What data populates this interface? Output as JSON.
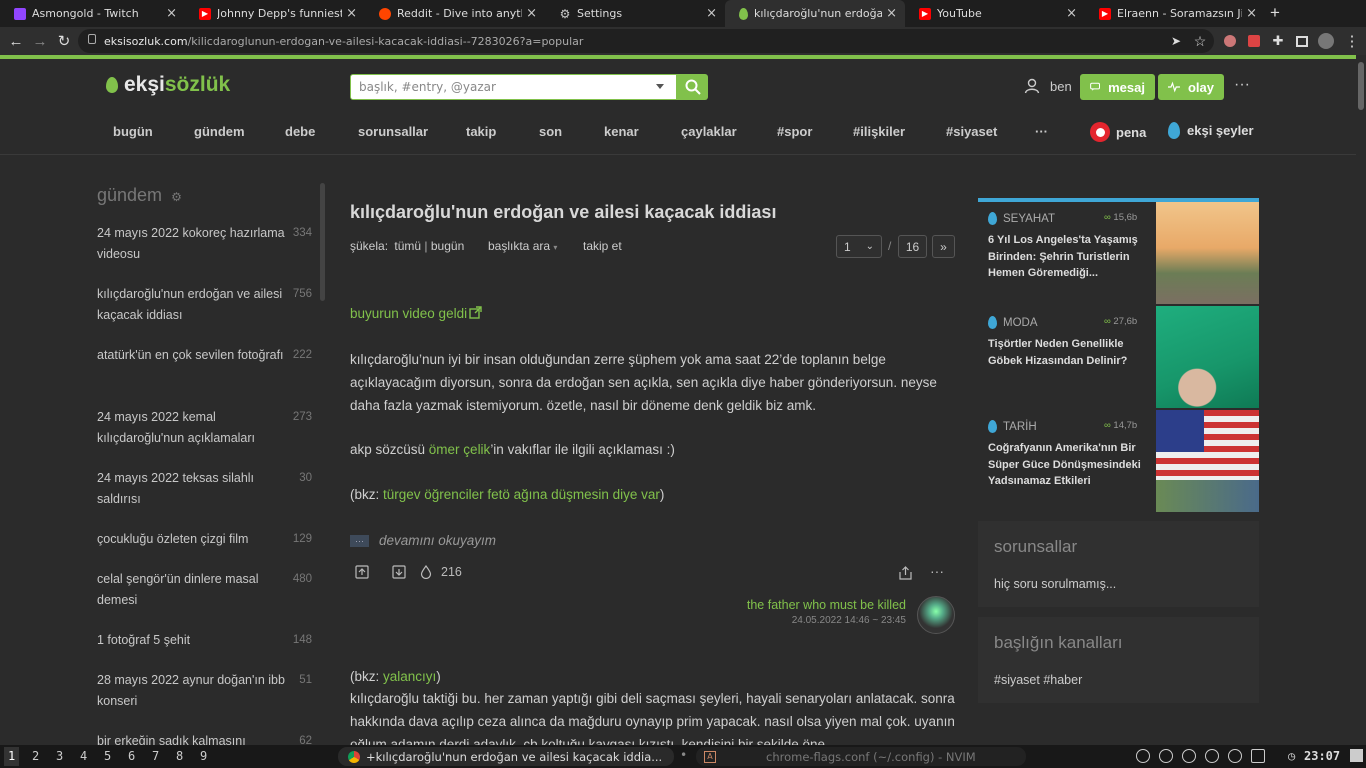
{
  "browser": {
    "tabs": [
      {
        "label": "Asmongold - Twitch",
        "icon": "twitch-icon",
        "color": "#9146ff"
      },
      {
        "label": "Johnny Depp's funniest mom",
        "icon": "youtube-icon",
        "color": "#ff0000"
      },
      {
        "label": "Reddit - Dive into anything",
        "icon": "reddit-icon",
        "color": "#ff4500"
      },
      {
        "label": "Settings",
        "icon": "gear-icon",
        "color": "#cccccc"
      },
      {
        "label": "kılıçdaroğlu'nun erdoğan ve",
        "icon": "eksi-drop-icon",
        "color": "#81c14b"
      },
      {
        "label": "YouTube",
        "icon": "youtube-icon",
        "color": "#ff0000"
      },
      {
        "label": "Elraenn - Soramazsın Jigolo İz",
        "icon": "youtube-icon",
        "color": "#ff0000"
      }
    ],
    "new_tab": "+",
    "url_host": "eksisozluk.com",
    "url_path": "/kilicdaroglunun-erdogan-ve-ailesi-kacacak-iddiasi--7283026?a=popular"
  },
  "site": {
    "logo_part1": "ekşi",
    "logo_part2": "sözlük",
    "search_placeholder": "başlık, #entry, @yazar",
    "user_label": "ben",
    "message_label": "mesaj",
    "event_label": "olay",
    "more": "···",
    "nav": [
      "bugün",
      "gündem",
      "debe",
      "sorunsallar",
      "takip",
      "son",
      "kenar",
      "çaylaklar",
      "#spor",
      "#ilişkiler",
      "#siyaset",
      "···"
    ],
    "pena_label": "pena",
    "eksiseyler_label": "ekşi şeyler",
    "accent": "#81c14b"
  },
  "gundem": {
    "title": "gündem",
    "items": [
      {
        "title": "24 mayıs 2022 kokoreç hazırlama videosu",
        "count": "334"
      },
      {
        "title": "kılıçdaroğlu'nun erdoğan ve ailesi kaçacak iddiası",
        "count": "756"
      },
      {
        "title": "atatürk'ün en çok sevilen fotoğrafı",
        "count": "222"
      },
      {
        "title": "24 mayıs 2022 kemal kılıçdaroğlu'nun açıklamaları",
        "count": "273"
      },
      {
        "title": "24 mayıs 2022 teksas silahlı saldırısı",
        "count": "30"
      },
      {
        "title": "çocukluğu özleten çizgi film",
        "count": "129"
      },
      {
        "title": "celal şengör'ün dinlere masal demesi",
        "count": "480"
      },
      {
        "title": "1 fotoğraf 5 şehit",
        "count": "148"
      },
      {
        "title": "28 mayıs 2022 aynur doğan'ın ibb konseri",
        "count": "51"
      },
      {
        "title": "bir erkeğin sadık kalmasını",
        "count": "62"
      }
    ]
  },
  "topic": {
    "title": "kılıçdaroğlu'nun erdoğan ve ailesi kaçacak iddiası",
    "sukela_label": "şükela:",
    "sukela_all": "tümü",
    "sukela_sep": "|",
    "sukela_today": "bugün",
    "search_in": "başlıkta ara",
    "follow": "takip et",
    "page_current": "1",
    "page_sep": "/",
    "page_total": "16",
    "page_next": "»"
  },
  "entry1": {
    "link": "buyurun video geldi",
    "p1": "kılıçdaroğlu’nun iyi bir insan olduğundan zerre şüphem yok ama saat 22’de toplanın belge açıklayacağım diyorsun, sonra da erdoğan sen açıkla, sen açıkla diye haber gönderiyorsun. neyse daha fazla yazmak istemiyorum. özetle, nasıl bir döneme denk geldik biz amk.",
    "p2_pre": "akp sözcüsü ",
    "p2_link": "ömer çelik",
    "p2_post": "’in vakıflar ile ilgili açıklaması :)",
    "p3_pre": "(bkz: ",
    "p3_link": "türgev öğrenciler fetö ağına düşmesin diye var",
    "p3_post": ")",
    "more_badge": "···",
    "read_more": "devamını okuyayım",
    "fav_count": "216",
    "author": "the father who must be killed",
    "date": "24.05.2022 14:46 ~ 23:45"
  },
  "entry2": {
    "p1_pre": "(bkz: ",
    "p1_link": "yalancıyı",
    "p1_post": ")",
    "p2": "kılıçdaroğlu taktiği bu. her zaman yaptığı gibi deli saçması şeyleri, hayali senaryoları anlatacak. sonra hakkında dava açılıp ceza alınca da mağduru oynayıp prim yapacak. nasıl olsa yiyen mal çok. uyanın oğlum adamın derdi adaylık. cb koltuğu kavgası kızıştı, kendisini bir şekilde öne"
  },
  "sidebar": {
    "cards": [
      {
        "category": "SEYAHAT",
        "views": "15,6b",
        "title": "6 Yıl Los Angeles'ta Yaşamış Birinden: Şehrin Turistlerin Hemen Göremediği..."
      },
      {
        "category": "MODA",
        "views": "27,6b",
        "title": "Tişörtler Neden Genellikle Göbek Hizasından Delinir?"
      },
      {
        "category": "TARİH",
        "views": "14,7b",
        "title": "Coğrafyanın Amerika'nın Bir Süper Güce Dönüşmesindeki Yadsınamaz Etkileri"
      }
    ],
    "sorunsallar_title": "sorunsallar",
    "sorunsallar_empty": "hiç soru sorulmamış...",
    "channels_title": "başlığın kanalları",
    "channels": "#siyaset #haber"
  },
  "taskbar": {
    "workspaces": [
      "1",
      "2",
      "3",
      "4",
      "5",
      "6",
      "7",
      "8",
      "9"
    ],
    "window1": "+kılıçdaroğlu'nun erdoğan ve ailesi kaçacak iddia...",
    "window2": "chrome-flags.conf (~/.config) - NVIM",
    "clock": "23:07"
  }
}
